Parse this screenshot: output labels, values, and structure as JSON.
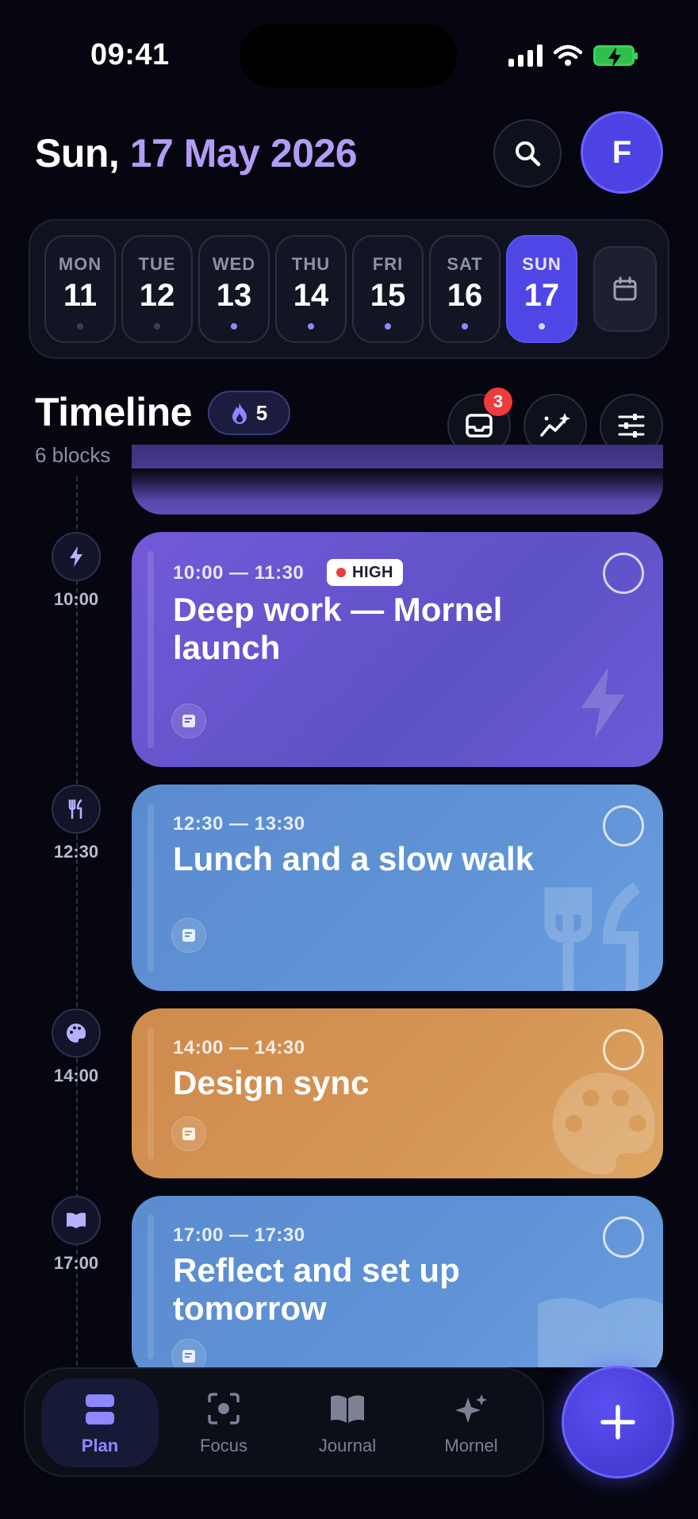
{
  "status_bar": {
    "time": "09:41"
  },
  "header": {
    "date_prefix": "Sun, ",
    "date_accent": "17 May 2026",
    "avatar_initial": "F"
  },
  "week": [
    {
      "name": "MON",
      "num": "11",
      "has_event": false
    },
    {
      "name": "TUE",
      "num": "12",
      "has_event": false
    },
    {
      "name": "WED",
      "num": "13",
      "has_event": true
    },
    {
      "name": "THU",
      "num": "14",
      "has_event": true
    },
    {
      "name": "FRI",
      "num": "15",
      "has_event": true
    },
    {
      "name": "SAT",
      "num": "16",
      "has_event": true
    },
    {
      "name": "SUN",
      "num": "17",
      "has_event": true,
      "selected": true
    }
  ],
  "timeline": {
    "title": "Timeline",
    "subtitle": "6 blocks",
    "streak": "5",
    "inbox_badge": "3"
  },
  "blocks": [
    {
      "rail_time": "10:00",
      "time": "10:00 — 11:30",
      "priority": "HIGH",
      "title": "Deep work — Mornel launch",
      "icon": "bolt-icon"
    },
    {
      "rail_time": "12:30",
      "time": "12:30 — 13:30",
      "title": "Lunch and a slow walk",
      "icon": "fork-knife-icon"
    },
    {
      "rail_time": "14:00",
      "time": "14:00 — 14:30",
      "title": "Design sync",
      "icon": "palette-icon"
    },
    {
      "rail_time": "17:00",
      "time": "17:00 — 17:30",
      "title": "Reflect and set up tomorrow",
      "icon": "book-icon"
    }
  ],
  "nav": {
    "tabs": [
      "Plan",
      "Focus",
      "Journal",
      "Mornel"
    ],
    "active": "Plan"
  },
  "colors": {
    "background": "#05060f",
    "accent": "#5046e6",
    "date_accent": "#b39cf5",
    "deep_work": "#6a57d2",
    "lunch": "#5f93d6",
    "design_sync": "#d59555",
    "badge": "#ef3b3b"
  }
}
